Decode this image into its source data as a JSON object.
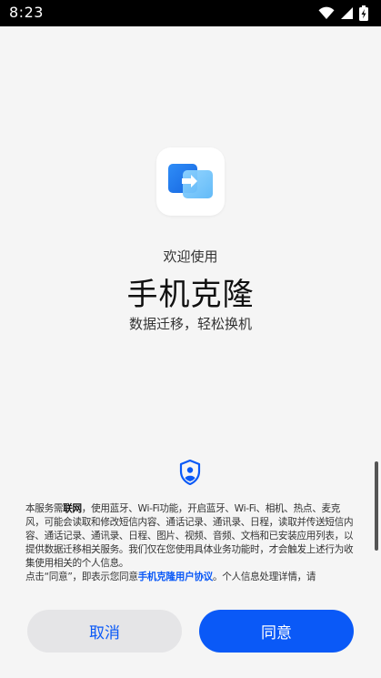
{
  "status_bar": {
    "time": "8:23",
    "icons": [
      "wifi-icon",
      "signal-icon",
      "battery-charging-icon"
    ]
  },
  "app": {
    "icon": "phone-clone-icon",
    "welcome": "欢迎使用",
    "title": "手机克隆",
    "subtitle": "数据迁移，轻松换机"
  },
  "privacy": {
    "icon": "privacy-shield-icon",
    "para1_prefix": "本服务需",
    "para1_bold": "联网",
    "para1_rest": "，使用蓝牙、Wi-Fi功能，开启蓝牙、Wi-Fi、相机、热点、麦克风，可能会读取和修改短信内容、通话记录、通讯录、日程，读取并传送短信内容、通话记录、通讯录、日程、图片、视频、音频、文档和已安装应用列表，以提供数据迁移相关服务。我们仅在您使用具体业务功能时，才会触发上述行为收集使用相关的个人信息。",
    "para2_prefix": "点击“同意”，即表示您同意",
    "para2_link": "手机克隆用户协议",
    "para2_rest": "。个人信息处理详情，请"
  },
  "buttons": {
    "cancel": "取消",
    "agree": "同意"
  },
  "colors": {
    "accent": "#0a59f7",
    "background": "#f5f5f5",
    "cancel_bg": "#e5e5e7"
  }
}
